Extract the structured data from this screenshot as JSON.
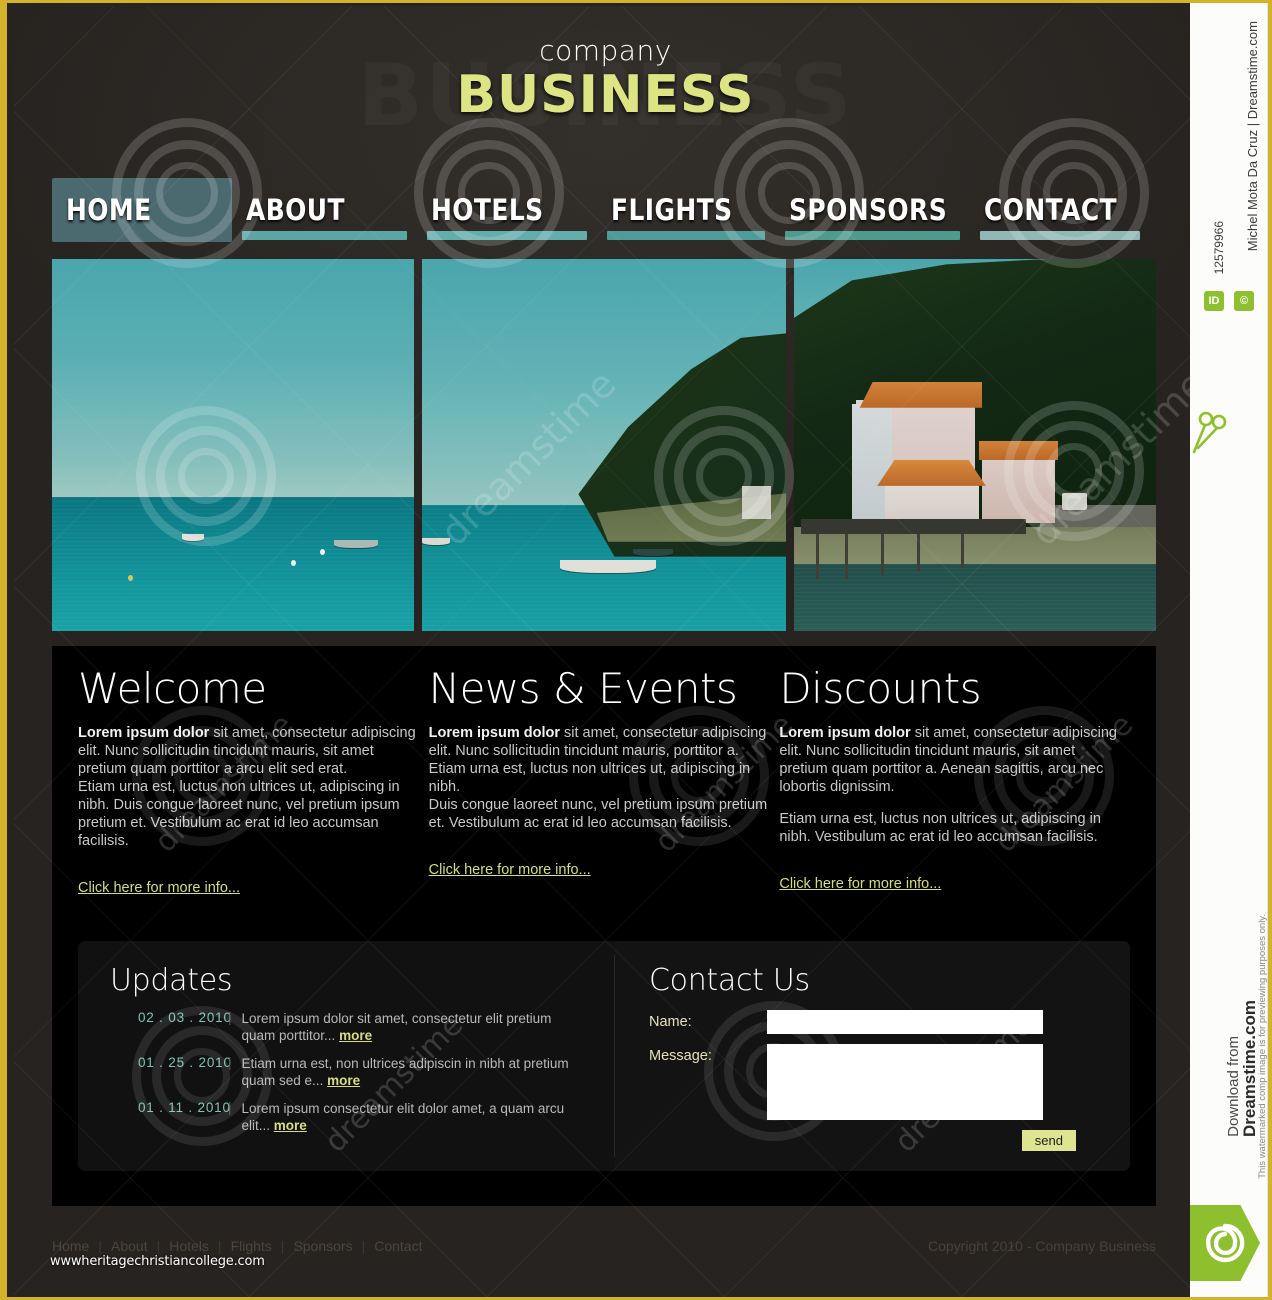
{
  "site": {
    "logo_top": "company",
    "logo_main": "BUSINESS",
    "ghost_text": "BUSINESS"
  },
  "nav": {
    "items": [
      {
        "label": "HOME",
        "active": true,
        "bar": ""
      },
      {
        "label": "ABOUT",
        "active": false,
        "bar": "#5ba6a4"
      },
      {
        "label": "HOTELS",
        "active": false,
        "bar": "#63aeab"
      },
      {
        "label": "FLIGHTS",
        "active": false,
        "bar": "#4f9b97"
      },
      {
        "label": "SPONSORS",
        "active": false,
        "bar": "#4e9a8f"
      },
      {
        "label": "CONTACT",
        "active": false,
        "bar": "#8fb8b6"
      }
    ]
  },
  "hero": {
    "images": [
      {
        "alt": "calm-sea-with-moored-boats"
      },
      {
        "alt": "rocky-coastline-with-white-boat"
      },
      {
        "alt": "coastal-house-with-orange-roof"
      }
    ]
  },
  "columns": [
    {
      "heading": "Welcome",
      "lead": "Lorem ipsum dolor",
      "body1": " sit amet, consectetur adipiscing elit. Nunc sollicitudin tincidunt mauris, sit amet pretium quam porttitor a arcu elit sed erat.",
      "body2": "Etiam urna est, luctus non ultrices ut, adipiscing in nibh. Duis congue laoreet nunc, vel pretium ipsum pretium et. Vestibulum ac erat id leo accumsan facilisis.",
      "link": "Click here for more info..."
    },
    {
      "heading": "News & Events",
      "lead": "Lorem ipsum dolor",
      "body1": " sit amet, consectetur adipiscing elit. Nunc sollicitudin tincidunt mauris, porttitor a.",
      "body2": "Etiam urna est, luctus non ultrices ut, adipiscing in nibh.",
      "body3": "Duis congue laoreet nunc, vel pretium ipsum pretium et. Vestibulum ac erat id leo accumsan facilisis.",
      "link": "Click here for more info..."
    },
    {
      "heading": "Discounts",
      "lead": "Lorem ipsum dolor",
      "body1": " sit amet, consectetur adipiscing elit. Nunc sollicitudin tincidunt mauris, sit amet pretium quam porttitor a. Aenean sagittis, arcu nec lobortis dignissim.",
      "body2": "Etiam urna est, luctus non ultrices ut, adipiscing in nibh. Vestibulum ac erat id leo accumsan facilisis.",
      "link": "Click here for more info..."
    }
  ],
  "updates": {
    "heading": "Updates",
    "separator": "|",
    "more_label": "more",
    "rows": [
      {
        "date": "02 . 03 . 2010",
        "text": "Lorem ipsum dolor sit amet, consectetur elit pretium quam porttitor..."
      },
      {
        "date": "01 . 25 . 2010",
        "text": "Etiam urna est, non ultrices adipiscin in nibh at pretium quam sed e..."
      },
      {
        "date": "01 . 11 . 2010",
        "text": "Lorem ipsum consectetur elit dolor amet, a quam arcu elit..."
      }
    ]
  },
  "contact": {
    "heading": "Contact Us",
    "name_label": "Name:",
    "name_value": "",
    "name_placeholder": "",
    "message_label": "Message:",
    "message_value": "",
    "message_placeholder": "",
    "send_label": "send"
  },
  "footer": {
    "links": [
      "Home",
      "About",
      "Hotels",
      "Flights",
      "Sponsors",
      "Contact"
    ],
    "separator": "|",
    "copyright": "Copyright 2010 - Company Business"
  },
  "watermark": {
    "url": "wwwheritagechristiancollege.com",
    "word": "dreamstime"
  },
  "rail": {
    "image_id": "12579966",
    "author": "Michel Mota Da Cruz | Dreamstime.com",
    "id_badge": "ID",
    "copyright_badge": "©",
    "download_from": "Download from",
    "brand": "Dreamstime.com",
    "note": "This watermarked comp image is for previewing purposes only."
  },
  "colors": {
    "accent_yellow": "#dde483",
    "nav_active_bg": "#4b6a70",
    "date_teal": "#7fc3b4",
    "border_gold": "#d4b32c",
    "dreamstime_green": "#8dbf2e"
  }
}
